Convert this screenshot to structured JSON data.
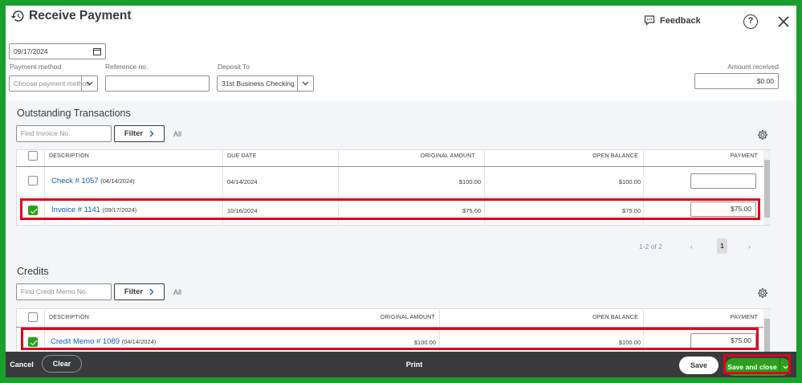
{
  "header": {
    "title": "Receive Payment",
    "feedback_label": "Feedback",
    "help_label": "?"
  },
  "form": {
    "date_value": "09/17/2024",
    "payment_method_label": "Payment method",
    "payment_method_placeholder": "Choose payment method",
    "reference_label": "Reference no.",
    "reference_value": "",
    "deposit_to_label": "Deposit To",
    "deposit_to_value": "31st Business Checking",
    "amount_received_label": "Amount received",
    "amount_received_value": "$0.00"
  },
  "outstanding": {
    "title": "Outstanding Transactions",
    "search_placeholder": "Find Invoice No.",
    "filter_label": "Filter",
    "all_label": "All",
    "columns": [
      "DESCRIPTION",
      "DUE DATE",
      "ORIGINAL AMOUNT",
      "OPEN BALANCE",
      "PAYMENT"
    ],
    "rows": [
      {
        "name": "Check # 1057",
        "date": "(04/14/2024)",
        "due": "04/14/2024",
        "original": "$100.00",
        "open": "$100.00",
        "payment": "",
        "checked": false
      },
      {
        "name": "Invoice # 1141",
        "date": "(09/17/2024)",
        "due": "10/16/2024",
        "original": "$75.00",
        "open": "$75.00",
        "payment": "$75.00",
        "checked": true
      }
    ],
    "pagination_text": "1-2 of 2",
    "current_page": "1"
  },
  "credits": {
    "title": "Credits",
    "search_placeholder": "Find Credit Memo No.",
    "filter_label": "Filter",
    "all_label": "All",
    "columns": [
      "DESCRIPTION",
      "ORIGINAL AMOUNT",
      "OPEN BALANCE",
      "PAYMENT"
    ],
    "rows": [
      {
        "name": "Credit Memo # 1089",
        "date": "(04/14/2024)",
        "original": "$100.00",
        "open": "$100.00",
        "payment": "$75.00",
        "checked": true
      }
    ]
  },
  "footer": {
    "cancel_label": "Cancel",
    "clear_label": "Clear",
    "print_label": "Print",
    "save_label": "Save",
    "save_close_label": "Save and close"
  },
  "colors": {
    "accent_green": "#2ca01c",
    "highlight_red": "#e0001b",
    "link_blue": "#0d5eb8",
    "footer_dark": "#393a3d"
  }
}
